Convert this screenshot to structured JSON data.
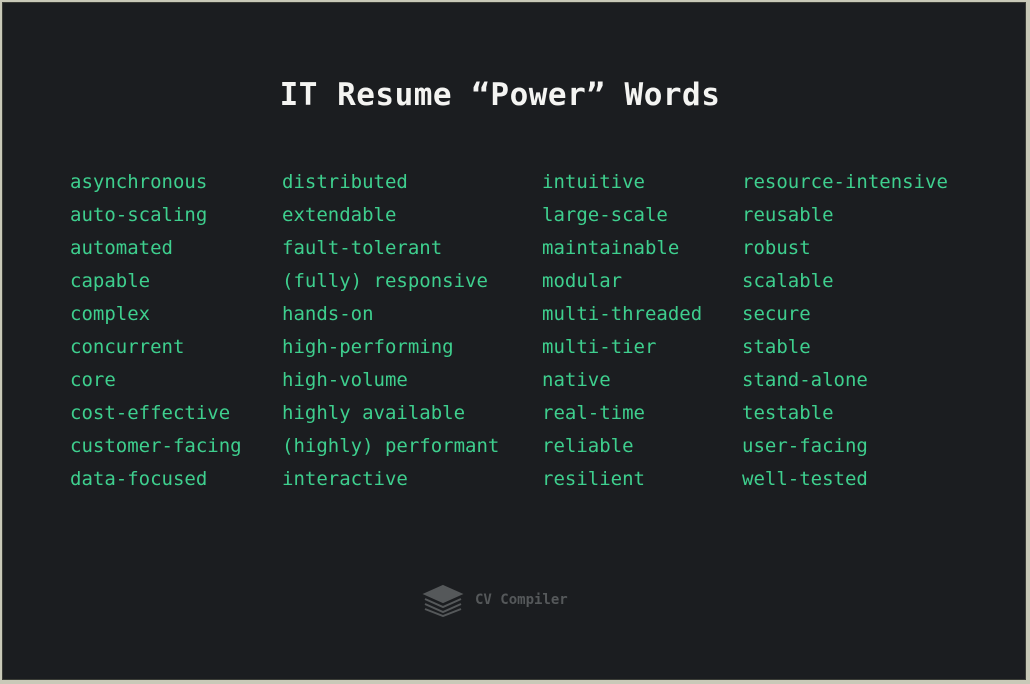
{
  "title": "IT Resume “Power” Words",
  "columns": [
    [
      "asynchronous",
      "auto-scaling",
      "automated",
      "capable",
      "complex",
      "concurrent",
      "core",
      "cost-effective",
      "customer-facing",
      "data-focused"
    ],
    [
      "distributed",
      "extendable",
      "fault-tolerant",
      "(fully) responsive",
      "hands-on",
      "high-performing",
      "high-volume",
      "highly available",
      "(highly) performant",
      "interactive"
    ],
    [
      "intuitive",
      "large-scale",
      "maintainable",
      "modular",
      "multi-threaded",
      "multi-tier",
      "native",
      "real-time",
      "reliable",
      "resilient"
    ],
    [
      "resource-intensive",
      "reusable",
      "robust",
      "scalable",
      "secure",
      "stable",
      "stand-alone",
      "testable",
      "user-facing",
      "well-tested"
    ]
  ],
  "brand": {
    "name": "CV Compiler",
    "icon": "layers-icon"
  },
  "colors": {
    "accent": "#3ecf8e",
    "background": "#1b1d20",
    "title": "#f4f4f2"
  }
}
